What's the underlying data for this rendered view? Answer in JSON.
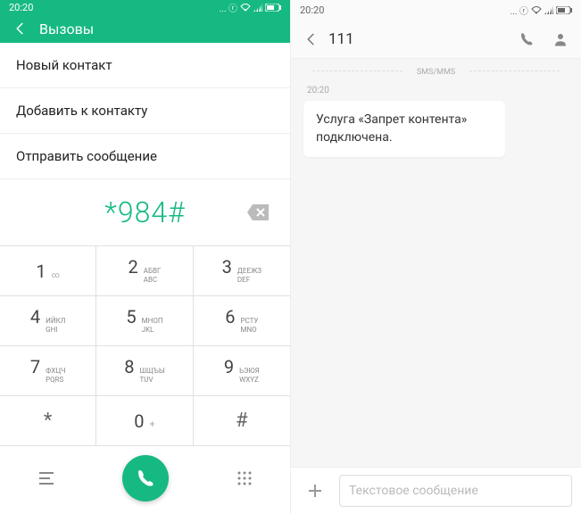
{
  "status": {
    "time": "20:20",
    "icons": "...  ⓡ"
  },
  "left": {
    "header_title": "Вызовы",
    "menu": {
      "new_contact": "Новый контакт",
      "add_to_contact": "Добавить к контакту",
      "send_message": "Отправить сообщение"
    },
    "dialed_number": "*984#",
    "keys": {
      "k1": "1",
      "k1_sub": "∞",
      "k2": "2",
      "k2_ru": "АБВГ",
      "k2_en": "ABC",
      "k3": "3",
      "k3_ru": "ДЕЕЖЗ",
      "k3_en": "DEF",
      "k4": "4",
      "k4_ru": "ИЙКЛ",
      "k4_en": "GHI",
      "k5": "5",
      "k5_ru": "МНОП",
      "k5_en": "JKL",
      "k6": "6",
      "k6_ru": "РСТУ",
      "k6_en": "MNO",
      "k7": "7",
      "k7_ru": "ФХЦЧ",
      "k7_en": "PQRS",
      "k8": "8",
      "k8_ru": "ШЩЪЫ",
      "k8_en": "TUV",
      "k9": "9",
      "k9_ru": "ЬЭЮЯ",
      "k9_en": "WXYZ",
      "star": "*",
      "k0": "0",
      "k0_sub": "+",
      "hash": "#"
    }
  },
  "right": {
    "title": "111",
    "divider": "SMS/MMS",
    "msg_time": "20:20",
    "msg_text": "Услуга «Запрет контента» подключена.",
    "input_placeholder": "Текстовое сообщение"
  }
}
